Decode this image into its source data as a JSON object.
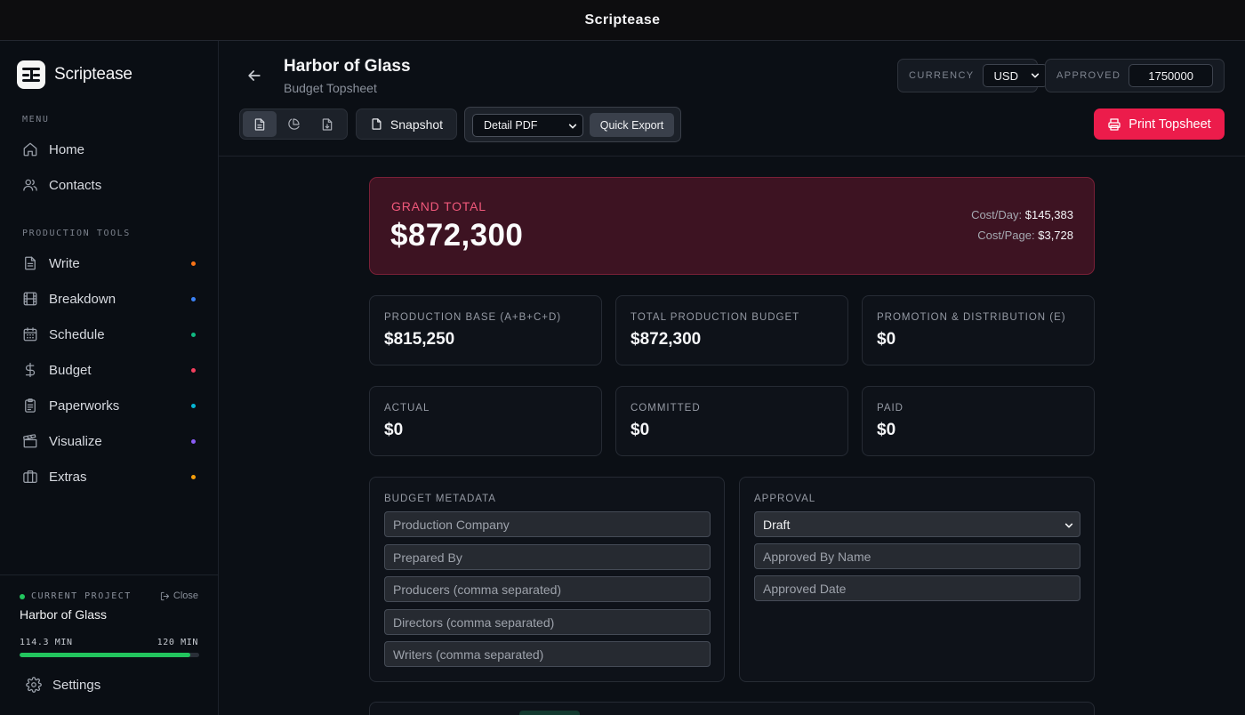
{
  "window": {
    "title": "Scriptease"
  },
  "brand": {
    "name": "Scriptease"
  },
  "sidebar": {
    "menu_label": "MENU",
    "menu_items": [
      {
        "label": "Home",
        "icon": "home-icon"
      },
      {
        "label": "Contacts",
        "icon": "users-icon"
      }
    ],
    "tools_label": "PRODUCTION TOOLS",
    "tool_items": [
      {
        "label": "Write",
        "icon": "document-icon",
        "dot_color": "#f97316"
      },
      {
        "label": "Breakdown",
        "icon": "film-icon",
        "dot_color": "#3b82f6"
      },
      {
        "label": "Schedule",
        "icon": "calendar-icon",
        "dot_color": "#10b981"
      },
      {
        "label": "Budget",
        "icon": "dollar-icon",
        "dot_color": "#f43f5e"
      },
      {
        "label": "Paperworks",
        "icon": "clipboard-icon",
        "dot_color": "#06b6d4"
      },
      {
        "label": "Visualize",
        "icon": "clapperboard-icon",
        "dot_color": "#8b5cf6"
      },
      {
        "label": "Extras",
        "icon": "briefcase-icon",
        "dot_color": "#f59e0b"
      }
    ],
    "project": {
      "label": "CURRENT PROJECT",
      "close_label": "Close",
      "name": "Harbor of Glass",
      "runtime_current": "114.3 MIN",
      "runtime_target": "120 MIN",
      "progress_fraction": 0.9525
    },
    "settings_label": "Settings"
  },
  "header": {
    "title": "Harbor of Glass",
    "subtitle": "Budget Topsheet",
    "currency": {
      "label": "CURRENCY",
      "value": "USD"
    },
    "approved": {
      "label": "APPROVED",
      "value": "1750000"
    },
    "snapshot_label": "Snapshot",
    "export_format": "Detail PDF",
    "quick_export_label": "Quick Export",
    "print_label": "Print Topsheet"
  },
  "grand_total": {
    "label": "GRAND TOTAL",
    "value": "$872,300",
    "cost_per_day_label": "Cost/Day:",
    "cost_per_day": "$145,383",
    "cost_per_page_label": "Cost/Page:",
    "cost_per_page": "$3,728"
  },
  "summary_cards": [
    {
      "label": "PRODUCTION BASE (A+B+C+D)",
      "value": "$815,250"
    },
    {
      "label": "TOTAL PRODUCTION BUDGET",
      "value": "$872,300"
    },
    {
      "label": "PROMOTION & DISTRIBUTION (E)",
      "value": "$0"
    },
    {
      "label": "ACTUAL",
      "value": "$0"
    },
    {
      "label": "COMMITTED",
      "value": "$0"
    },
    {
      "label": "PAID",
      "value": "$0"
    }
  ],
  "metadata": {
    "label": "BUDGET METADATA",
    "fields": [
      {
        "placeholder": "Production Company"
      },
      {
        "placeholder": "Prepared By"
      },
      {
        "placeholder": "Producers (comma separated)"
      },
      {
        "placeholder": "Directors (comma separated)"
      },
      {
        "placeholder": "Writers (comma separated)"
      }
    ]
  },
  "approval": {
    "label": "APPROVAL",
    "status": "Draft",
    "approved_by_placeholder": "Approved By Name",
    "approved_date_placeholder": "Approved Date"
  },
  "colors": {
    "accent": "#ec1c4b",
    "progress": "#22c55e",
    "grand_bg": "#3d1322"
  }
}
